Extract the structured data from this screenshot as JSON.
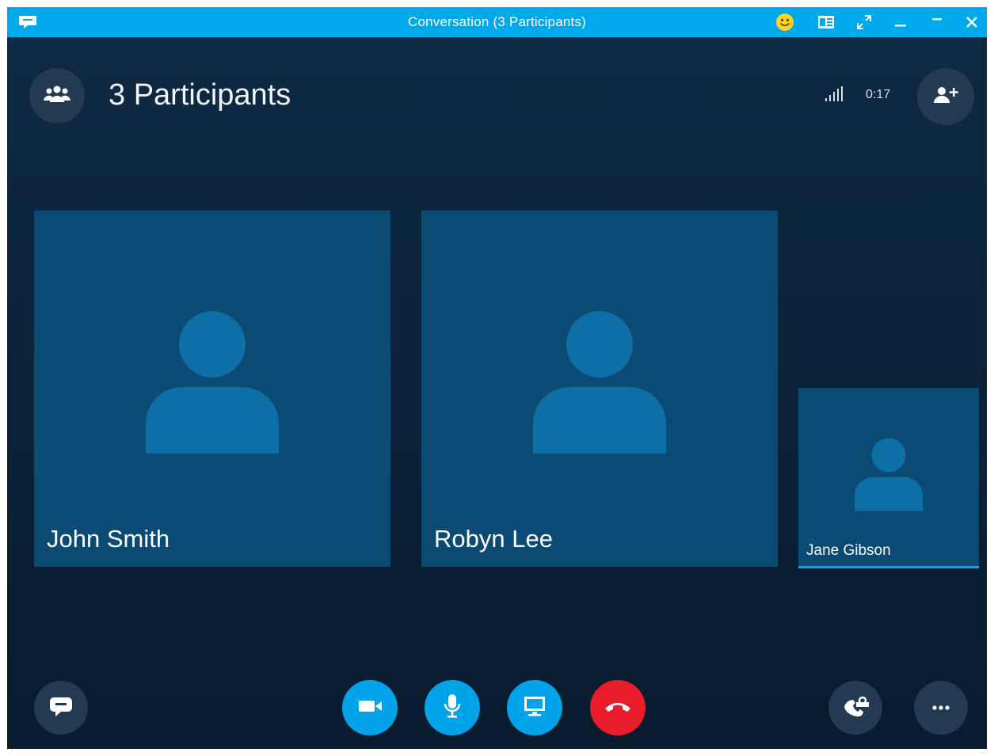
{
  "window": {
    "title": "Conversation (3 Participants)"
  },
  "titlebar": {
    "icons": [
      "chat-icon",
      "emoticon-icon",
      "contact-card-icon",
      "expand-icon",
      "minimize-icon",
      "maximize-icon",
      "close-icon"
    ]
  },
  "header": {
    "participants_label": "3 Participants",
    "call_timer": "0:17",
    "icons": [
      "participants-icon",
      "signal-strength-icon",
      "add-people-icon"
    ]
  },
  "tiles": [
    {
      "name": "John Smith"
    },
    {
      "name": "Robyn Lee"
    },
    {
      "name": "Jane Gibson",
      "active_speaker": true
    }
  ],
  "controls": {
    "icons": [
      "chat-icon",
      "video-icon",
      "microphone-icon",
      "screen-share-icon",
      "hang-up-icon",
      "dial-pad-icon",
      "more-icon"
    ]
  },
  "colors": {
    "titlebar": "#00a8ec",
    "background": "#0e2a43",
    "tile": "#0b4a73",
    "avatar": "#0e6ea6",
    "control_blue": "#00a3e8",
    "hang_up": "#e81c2b",
    "emoticon": "#ffd21e"
  }
}
